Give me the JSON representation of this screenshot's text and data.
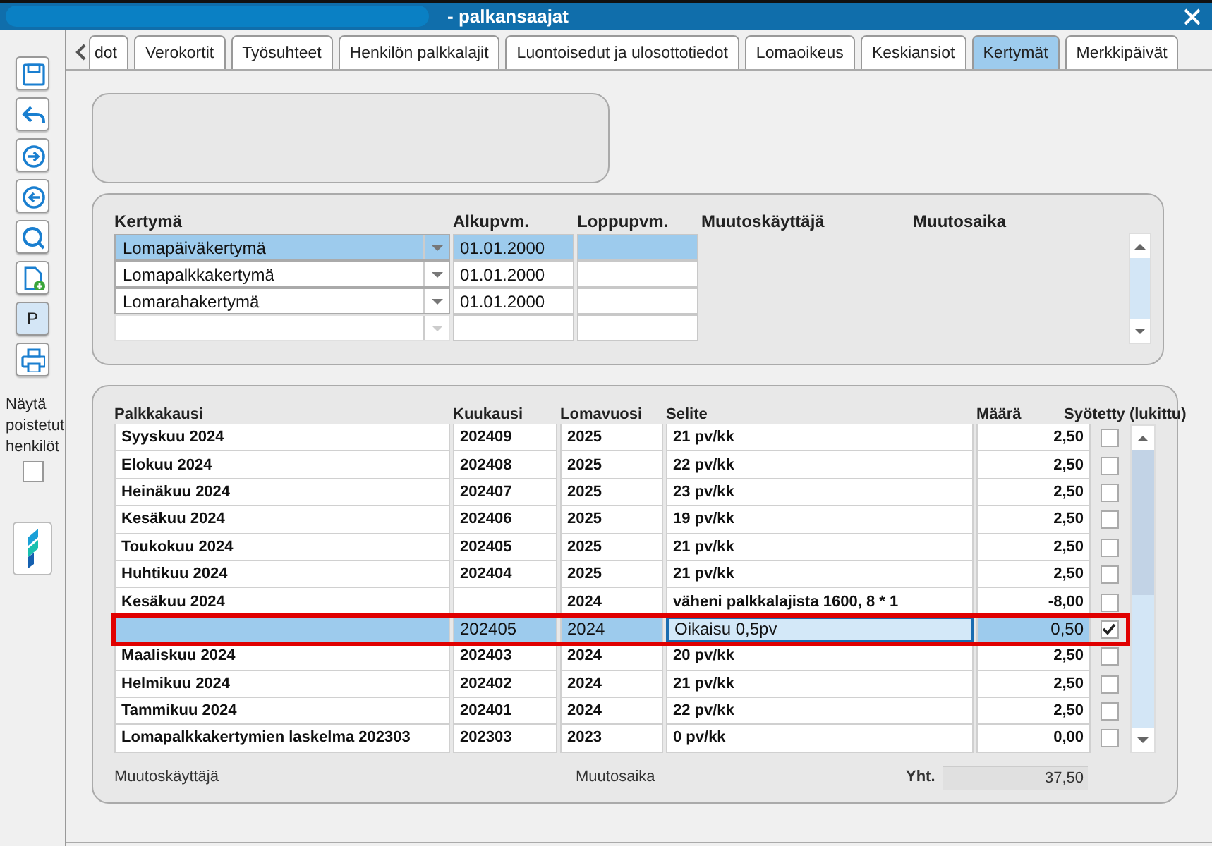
{
  "window": {
    "title": "- palkansaajat"
  },
  "sidebar": {
    "buttons": [
      {
        "kind": "save",
        "pressed": false
      },
      {
        "kind": "undo",
        "pressed": false
      },
      {
        "kind": "next",
        "pressed": false
      },
      {
        "kind": "previous",
        "pressed": false
      },
      {
        "kind": "search",
        "pressed": false
      },
      {
        "kind": "new",
        "pressed": false
      },
      {
        "kind": "text",
        "label": "P",
        "pressed": true
      },
      {
        "kind": "print",
        "pressed": false
      }
    ],
    "show_deleted": {
      "label": "Näytä poistetut henkilöt",
      "checked": false
    }
  },
  "tabs": [
    {
      "label": "dot",
      "selected": false
    },
    {
      "label": "Verokortit",
      "selected": false
    },
    {
      "label": "Työsuhteet",
      "selected": false
    },
    {
      "label": "Henkilön palkkalajit",
      "selected": false
    },
    {
      "label": "Luontoisedut ja ulosottotiedot",
      "selected": false
    },
    {
      "label": "Lomaoikeus",
      "selected": false
    },
    {
      "label": "Keskiansiot",
      "selected": false
    },
    {
      "label": "Kertymät",
      "selected": true
    },
    {
      "label": "Merkkipäivät",
      "selected": false
    }
  ],
  "accruals": {
    "columns": [
      "Kertymä",
      "Alkupvm.",
      "Loppupvm.",
      "Muutoskäyttäjä",
      "Muutosaika"
    ],
    "rows": [
      {
        "kind": "entry",
        "accrual": "Lomapäiväkertymä",
        "start": "01.01.2000",
        "selected": true
      },
      {
        "kind": "entry",
        "accrual": "Lomapalkkakertymä",
        "start": "01.01.2000",
        "selected": false
      },
      {
        "kind": "entry",
        "accrual": "Lomarahakertymä",
        "start": "01.01.2000",
        "selected": false
      },
      {
        "kind": "blank",
        "selected": false
      }
    ]
  },
  "periods": {
    "columns": [
      "Palkkakausi",
      "Kuukausi",
      "Lomavuosi",
      "Selite",
      "Määrä",
      "Syötetty (lukittu)"
    ],
    "rows": [
      {
        "period": "Syyskuu 2024",
        "month": "202409",
        "year": "2025",
        "description": "21 pv/kk",
        "amount": "2,50",
        "checked": false,
        "selected": false
      },
      {
        "period": "Elokuu 2024",
        "month": "202408",
        "year": "2025",
        "description": "22 pv/kk",
        "amount": "2,50",
        "checked": false,
        "selected": false
      },
      {
        "period": "Heinäkuu 2024",
        "month": "202407",
        "year": "2025",
        "description": "23 pv/kk",
        "amount": "2,50",
        "checked": false,
        "selected": false
      },
      {
        "period": "Kesäkuu 2024",
        "month": "202406",
        "year": "2025",
        "description": "19 pv/kk",
        "amount": "2,50",
        "checked": false,
        "selected": false
      },
      {
        "period": "Toukokuu 2024",
        "month": "202405",
        "year": "2025",
        "description": "21 pv/kk",
        "amount": "2,50",
        "checked": false,
        "selected": false
      },
      {
        "period": "Huhtikuu 2024",
        "month": "202404",
        "year": "2025",
        "description": "21 pv/kk",
        "amount": "2,50",
        "checked": false,
        "selected": false
      },
      {
        "period": "Kesäkuu 2024",
        "year": "2024",
        "description": "väheni palkkalajista 1600, 8 * 1",
        "amount": "-8,00",
        "checked": false,
        "selected": false
      },
      {
        "month": "202405",
        "year": "2024",
        "description": "Oikaisu 0,5pv",
        "amount": "0,50",
        "checked": true,
        "selected": true,
        "outlined": true
      },
      {
        "period": "Maaliskuu 2024",
        "month": "202403",
        "year": "2024",
        "description": "20 pv/kk",
        "amount": "2,50",
        "checked": false,
        "selected": false
      },
      {
        "period": "Helmikuu 2024",
        "month": "202402",
        "year": "2024",
        "description": "21 pv/kk",
        "amount": "2,50",
        "checked": false,
        "selected": false
      },
      {
        "period": "Tammikuu 2024",
        "month": "202401",
        "year": "2024",
        "description": "22 pv/kk",
        "amount": "2,50",
        "checked": false,
        "selected": false
      },
      {
        "period": "Lomapalkkakertymien laskelma 202303",
        "month": "202303",
        "year": "2023",
        "description": "0 pv/kk",
        "amount": "0,00",
        "checked": false,
        "selected": false
      }
    ],
    "footer": {
      "changed_by_label": "Muutoskäyttäjä",
      "changed_at_label": "Muutosaika",
      "total_label": "Yht.",
      "total": "37,50"
    }
  }
}
